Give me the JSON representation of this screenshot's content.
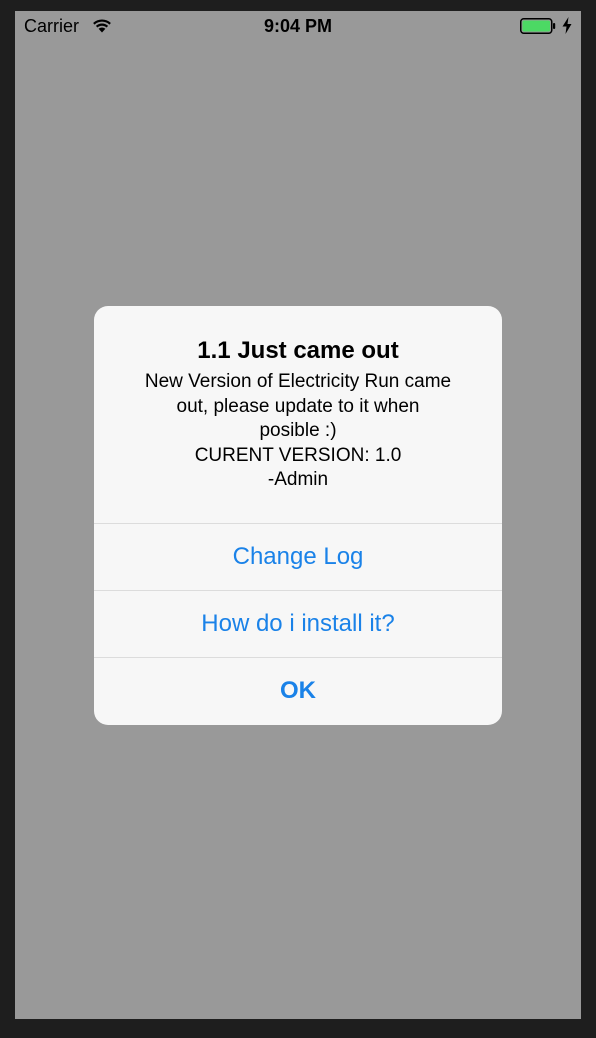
{
  "status_bar": {
    "carrier": "Carrier",
    "time": "9:04 PM",
    "wifi_icon": "wifi-icon",
    "battery_icon": "battery-icon",
    "charging_icon": "charging-bolt-icon",
    "battery_color": "#4cd964"
  },
  "alert": {
    "title": "1.1 Just came out",
    "message_lines": [
      "New Version of Electricity Run came",
      "out,  please update to it when",
      "posible :)",
      "CURENT VERSION: 1.0",
      "-Admin"
    ],
    "buttons": [
      {
        "label": "Change Log"
      },
      {
        "label": "How do i install it?"
      },
      {
        "label": "OK"
      }
    ],
    "button_color": "#1a82e8"
  }
}
